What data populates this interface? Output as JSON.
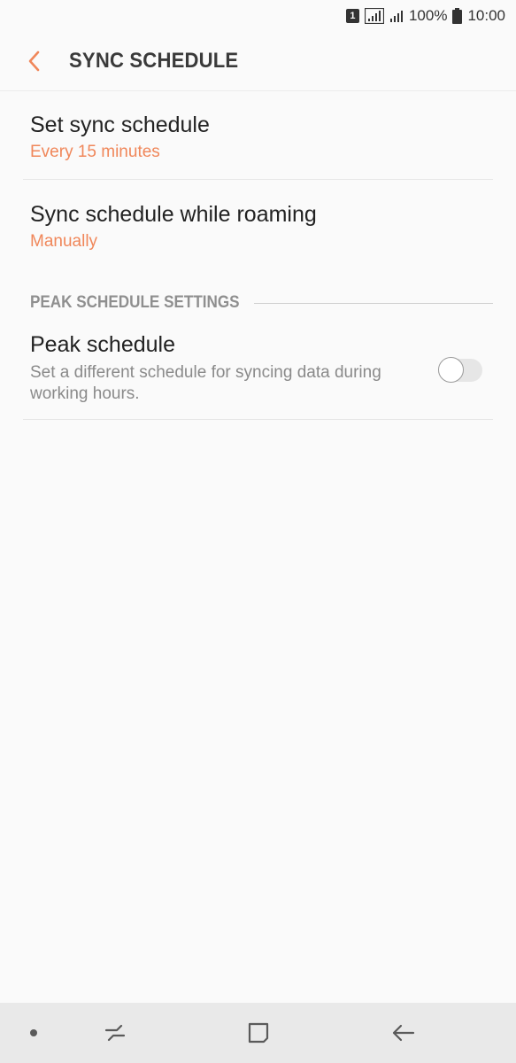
{
  "status_bar": {
    "sim_label": "1",
    "battery_text": "100%",
    "time": "10:00"
  },
  "app_bar": {
    "back_icon": "chevron-left-icon",
    "title": "SYNC SCHEDULE"
  },
  "settings": {
    "sync_schedule": {
      "title": "Set sync schedule",
      "value": "Every 15 minutes"
    },
    "roaming_schedule": {
      "title": "Sync schedule while roaming",
      "value": "Manually"
    },
    "peak_section": {
      "header": "PEAK SCHEDULE SETTINGS",
      "peak_schedule": {
        "title": "Peak schedule",
        "summary": "Set a different schedule for syncing data during working hours.",
        "enabled": false
      }
    }
  },
  "nav_bar": {
    "buttons": [
      "dot-icon",
      "recent-apps-icon",
      "home-icon",
      "back-arrow-icon"
    ]
  },
  "colors": {
    "accent": "#f0875a",
    "background": "#fafafa",
    "nav_background": "#e9e9e9"
  }
}
